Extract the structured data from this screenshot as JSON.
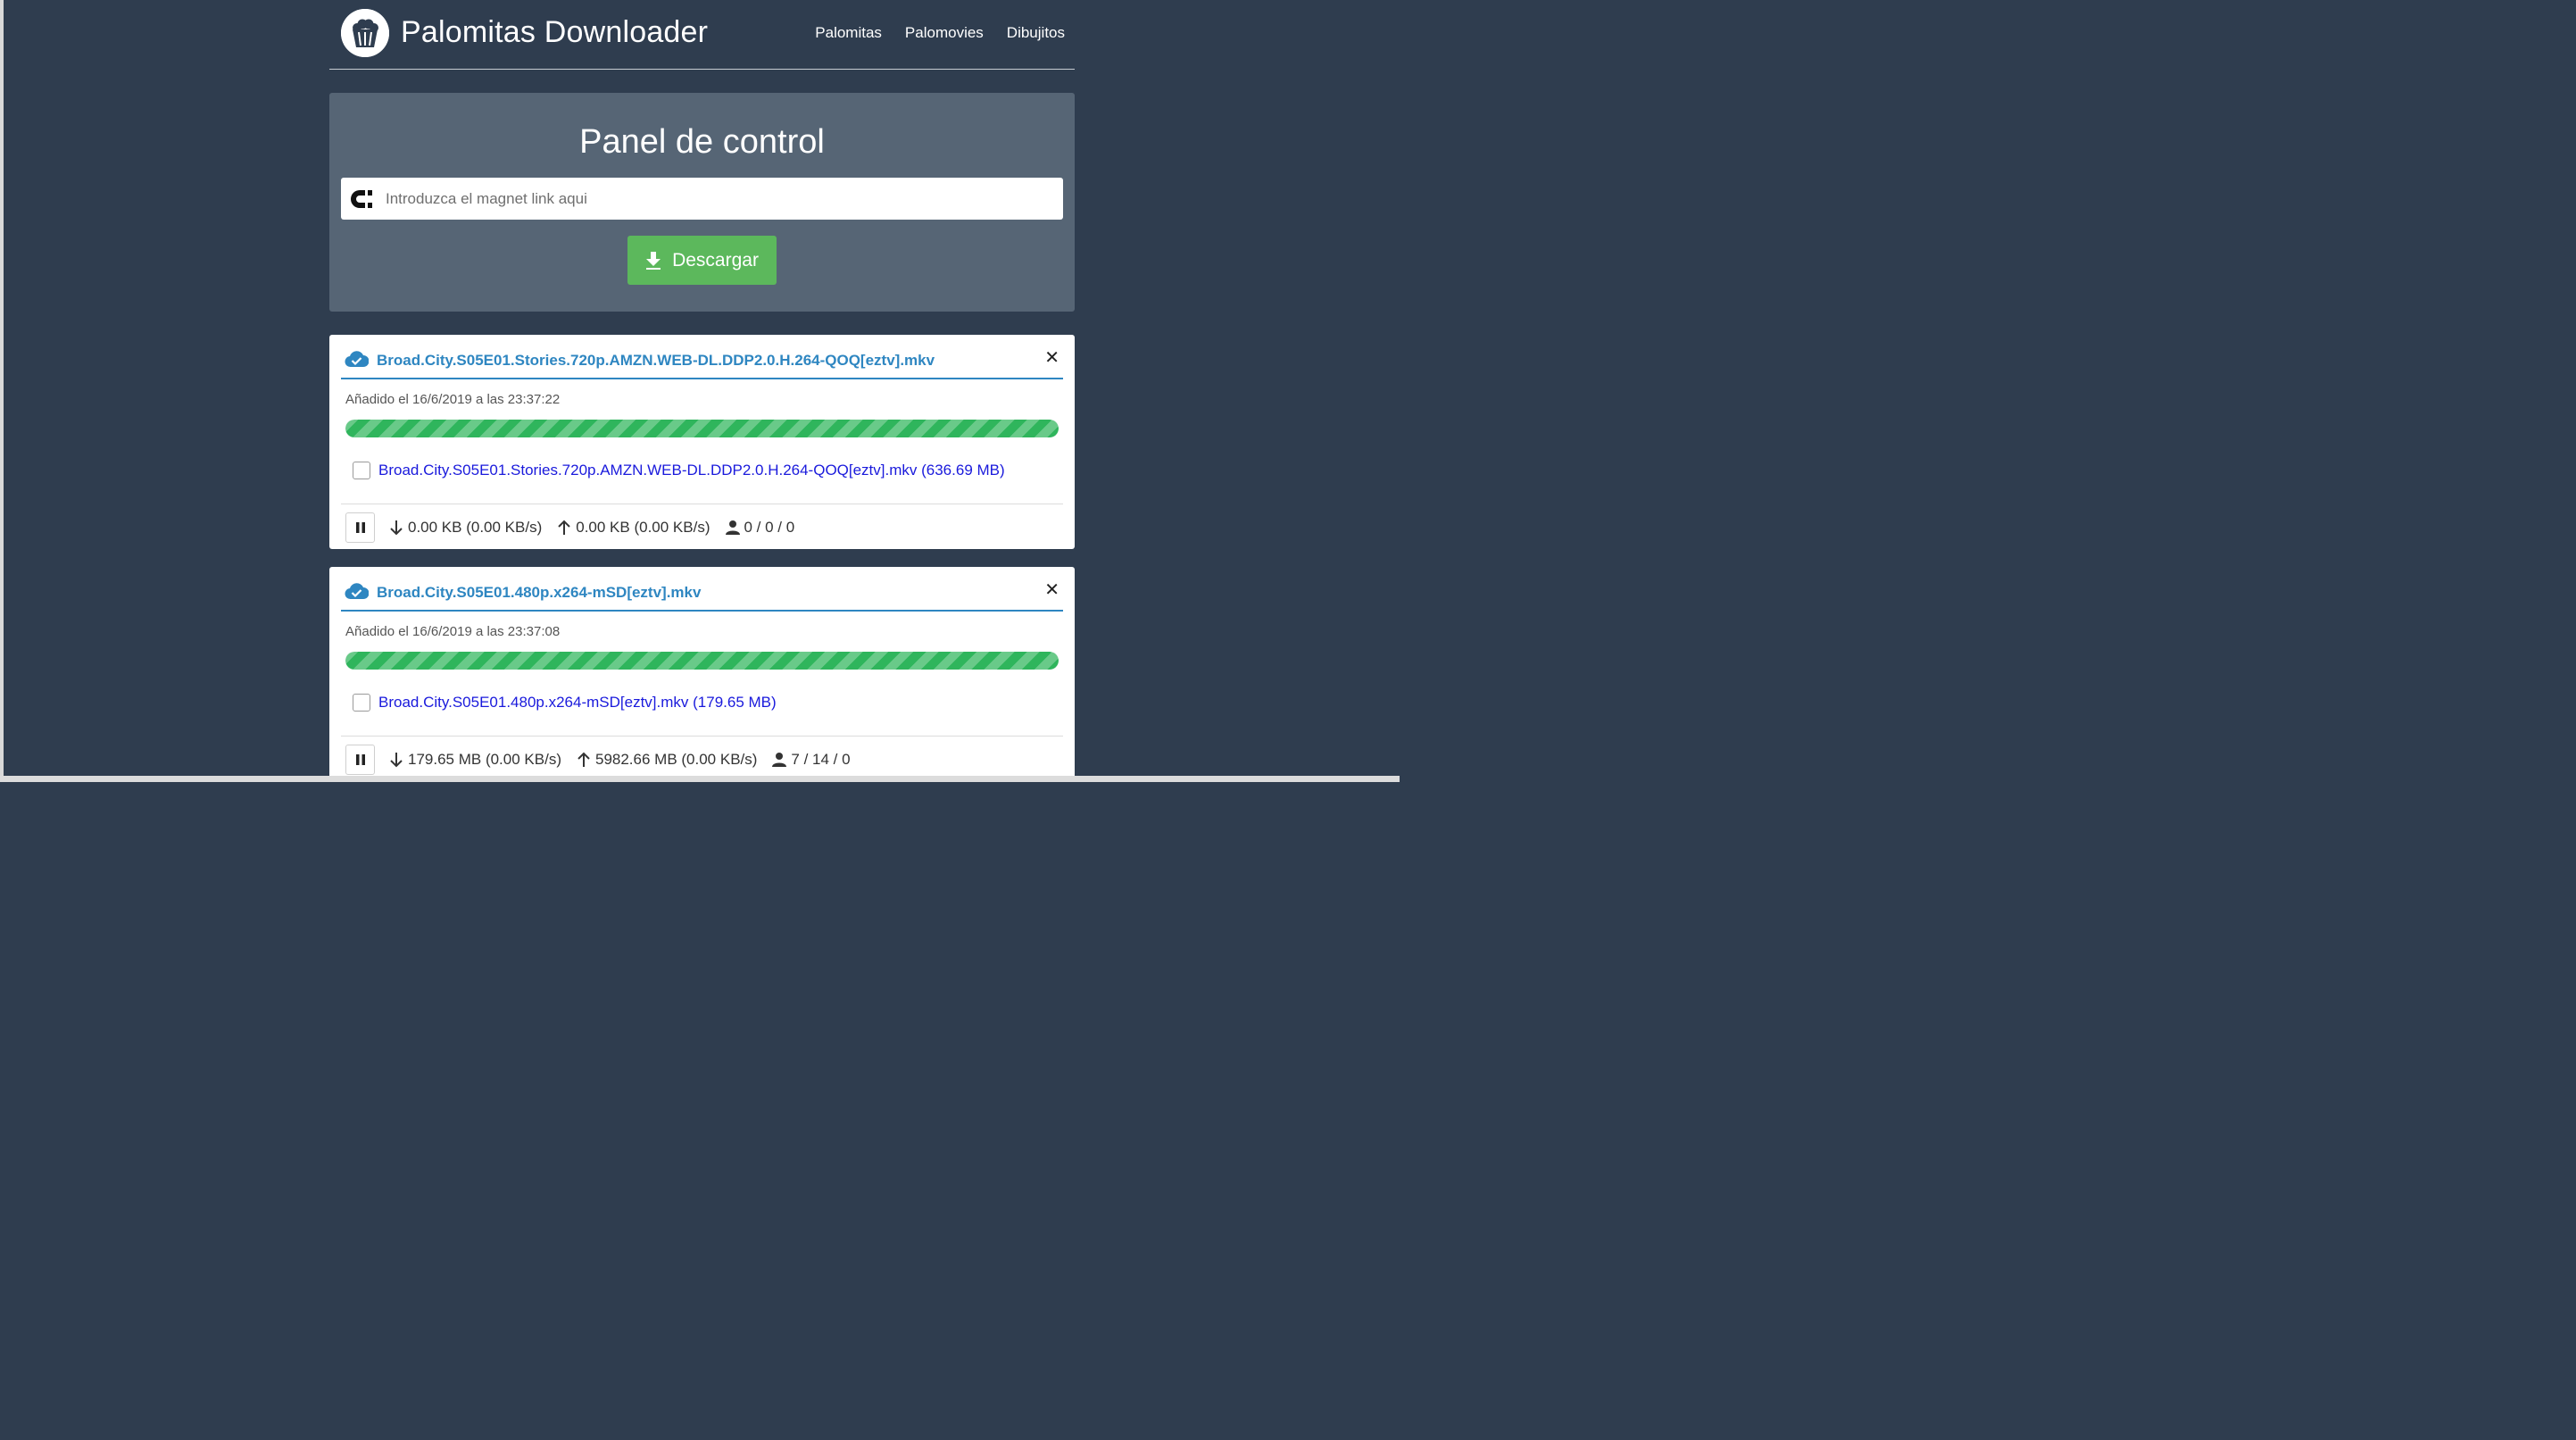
{
  "header": {
    "brand": "Palomitas Downloader",
    "nav": [
      "Palomitas",
      "Palomovies",
      "Dibujitos"
    ]
  },
  "panel": {
    "title": "Panel de control",
    "magnet_placeholder": "Introduzca el magnet link aqui",
    "download_label": "Descargar"
  },
  "torrents": [
    {
      "title": "Broad.City.S05E01.Stories.720p.AMZN.WEB-DL.DDP2.0.H.264-QOQ[eztv].mkv",
      "added": "Añadido el 16/6/2019 a las 23:37:22",
      "progress": 1.0,
      "file": "Broad.City.S05E01.Stories.720p.AMZN.WEB-DL.DDP2.0.H.264-QOQ[eztv].mkv (636.69 MB)",
      "download": "0.00 KB (0.00 KB/s)",
      "upload": "0.00 KB (0.00 KB/s)",
      "peers": "0 / 0 / 0"
    },
    {
      "title": "Broad.City.S05E01.480p.x264-mSD[eztv].mkv",
      "added": "Añadido el 16/6/2019 a las 23:37:08",
      "progress": 1.0,
      "file": "Broad.City.S05E01.480p.x264-mSD[eztv].mkv (179.65 MB)",
      "download": "179.65 MB (0.00 KB/s)",
      "upload": "5982.66 MB (0.00 KB/s)",
      "peers": "7 / 14 / 0"
    }
  ],
  "colors": {
    "background": "#2f3d4f",
    "panel": "#566575",
    "accent": "#2e86c1",
    "success": "#5cb85c",
    "progress": "#2fb55c",
    "link": "#1a1adc"
  },
  "icons": [
    "popcorn-logo-icon",
    "magnet-icon",
    "download-icon",
    "cloud-check-icon",
    "close-icon",
    "pause-icon",
    "arrow-down-icon",
    "arrow-up-icon",
    "user-icon"
  ]
}
